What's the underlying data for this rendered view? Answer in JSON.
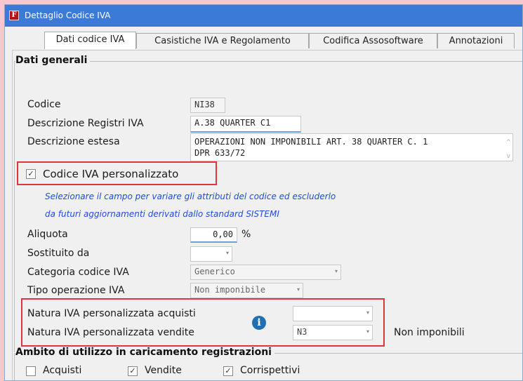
{
  "window": {
    "title": "Dettaglio Codice IVA"
  },
  "tabs": [
    {
      "label": "Dati codice IVA"
    },
    {
      "label": "Casistiche IVA e Regolamento"
    },
    {
      "label": "Codifica Assosoftware"
    },
    {
      "label": "Annotazioni"
    }
  ],
  "general": {
    "section_title": "Dati generali",
    "codice": {
      "label": "Codice",
      "value": "NI38"
    },
    "descr_registri": {
      "label": "Descrizione Registri IVA",
      "value": "A.38 QUARTER C1"
    },
    "descr_estesa": {
      "label": "Descrizione estesa",
      "line1": "OPERAZIONI NON IMPONIBILI ART. 38 QUARTER C. 1",
      "line2": "DPR 633/72"
    },
    "personalizzato": {
      "label": "Codice IVA personalizzato",
      "checked": true,
      "mark": "✓"
    },
    "hint": {
      "line1": "Selezionare il campo per variare gli attributi del codice ed escluderlo",
      "line2": "da futuri aggiornamenti derivati dallo standard SISTEMI"
    },
    "aliquota": {
      "label": "Aliquota",
      "value": "0,00",
      "unit": "%"
    },
    "sostituito": {
      "label": "Sostituito da",
      "value": ""
    },
    "categoria": {
      "label": "Categoria codice IVA",
      "value": "Generico"
    },
    "tipo_op": {
      "label": "Tipo operazione IVA",
      "value": "Non imponibile"
    },
    "natura_acquisti": {
      "label": "Natura IVA personalizzata acquisti",
      "value": ""
    },
    "natura_vendite": {
      "label": "Natura IVA personalizzata vendite",
      "value": "N3",
      "description": "Non imponibili"
    },
    "dropdown_glyph": "▾"
  },
  "ambito": {
    "section_title": "Ambito di utilizzo in caricamento registrazioni",
    "acquisti": {
      "label": "Acquisti",
      "checked": false,
      "mark": ""
    },
    "vendite": {
      "label": "Vendite",
      "checked": true,
      "mark": "✓"
    },
    "corrispettivi": {
      "label": "Corrispettivi",
      "checked": true,
      "mark": "✓"
    }
  },
  "colors": {
    "highlight": "#e0353c",
    "hint": "#1f4bd8",
    "titlebar": "#3b7ad6"
  }
}
